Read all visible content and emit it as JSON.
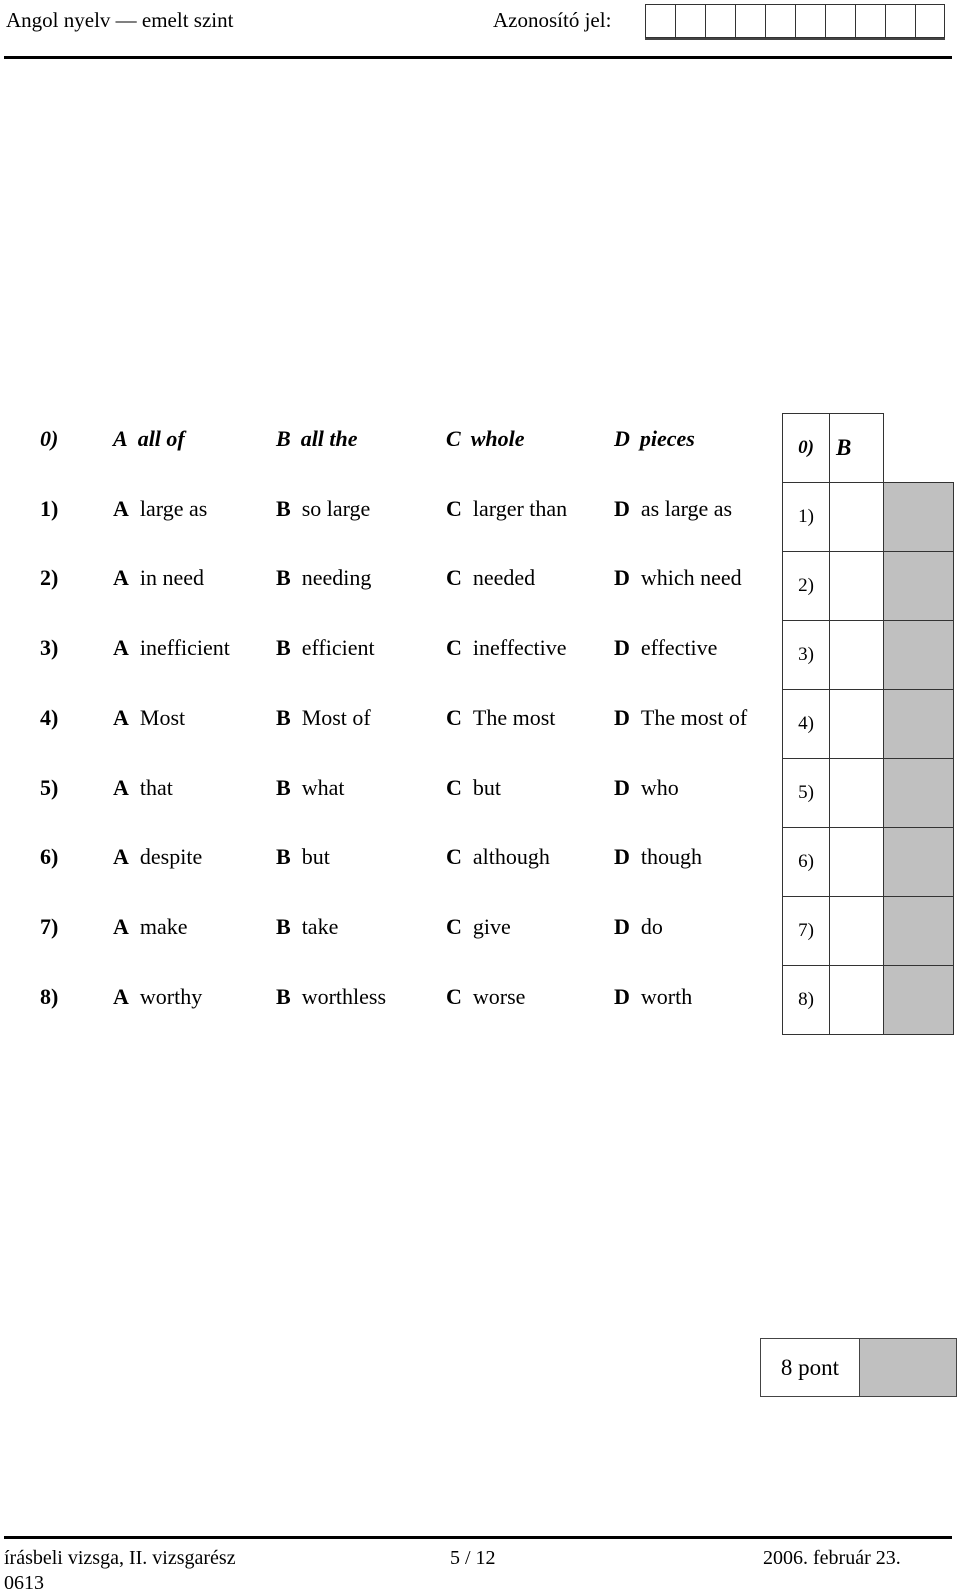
{
  "header": {
    "subject": "Angol nyelv — emelt szint",
    "id_label": "Azonosító jel:",
    "id_box_count": 10
  },
  "questions": [
    {
      "num": "0)",
      "example": true,
      "options": [
        {
          "letter": "A",
          "text": "all of"
        },
        {
          "letter": "B",
          "text": "all the"
        },
        {
          "letter": "C",
          "text": "whole"
        },
        {
          "letter": "D",
          "text": "pieces"
        }
      ]
    },
    {
      "num": "1)",
      "example": false,
      "options": [
        {
          "letter": "A",
          "text": "large as"
        },
        {
          "letter": "B",
          "text": "so large"
        },
        {
          "letter": "C",
          "text": "larger than"
        },
        {
          "letter": "D",
          "text": "as large as"
        }
      ]
    },
    {
      "num": "2)",
      "example": false,
      "options": [
        {
          "letter": "A",
          "text": "in need"
        },
        {
          "letter": "B",
          "text": "needing"
        },
        {
          "letter": "C",
          "text": "needed"
        },
        {
          "letter": "D",
          "text": "which need"
        }
      ]
    },
    {
      "num": "3)",
      "example": false,
      "options": [
        {
          "letter": "A",
          "text": "inefficient"
        },
        {
          "letter": "B",
          "text": "efficient"
        },
        {
          "letter": "C",
          "text": "ineffective"
        },
        {
          "letter": "D",
          "text": "effective"
        }
      ]
    },
    {
      "num": "4)",
      "example": false,
      "options": [
        {
          "letter": "A",
          "text": "Most"
        },
        {
          "letter": "B",
          "text": "Most of"
        },
        {
          "letter": "C",
          "text": "The most"
        },
        {
          "letter": "D",
          "text": "The most of"
        }
      ]
    },
    {
      "num": "5)",
      "example": false,
      "options": [
        {
          "letter": "A",
          "text": "that"
        },
        {
          "letter": "B",
          "text": "what"
        },
        {
          "letter": "C",
          "text": "but"
        },
        {
          "letter": "D",
          "text": "who"
        }
      ]
    },
    {
      "num": "6)",
      "example": false,
      "options": [
        {
          "letter": "A",
          "text": "despite"
        },
        {
          "letter": "B",
          "text": "but"
        },
        {
          "letter": "C",
          "text": "although"
        },
        {
          "letter": "D",
          "text": "though"
        }
      ]
    },
    {
      "num": "7)",
      "example": false,
      "options": [
        {
          "letter": "A",
          "text": "make"
        },
        {
          "letter": "B",
          "text": "take"
        },
        {
          "letter": "C",
          "text": "give"
        },
        {
          "letter": "D",
          "text": "do"
        }
      ]
    },
    {
      "num": "8)",
      "example": false,
      "options": [
        {
          "letter": "A",
          "text": "worthy"
        },
        {
          "letter": "B",
          "text": "worthless"
        },
        {
          "letter": "C",
          "text": "worse"
        },
        {
          "letter": "D",
          "text": "worth"
        }
      ]
    }
  ],
  "answer_table": {
    "rows": [
      {
        "num": "0)",
        "answer": "B",
        "example": true
      },
      {
        "num": "1)",
        "answer": ""
      },
      {
        "num": "2)",
        "answer": ""
      },
      {
        "num": "3)",
        "answer": ""
      },
      {
        "num": "4)",
        "answer": ""
      },
      {
        "num": "5)",
        "answer": ""
      },
      {
        "num": "6)",
        "answer": ""
      },
      {
        "num": "7)",
        "answer": ""
      },
      {
        "num": "8)",
        "answer": ""
      }
    ],
    "score_fill_color": "#c0c0c0"
  },
  "points": {
    "label": "8 pont"
  },
  "footer": {
    "left": "írásbeli vizsga, II. vizsgarész",
    "code": "0613",
    "center": "5 / 12",
    "right": "2006. február 23."
  }
}
